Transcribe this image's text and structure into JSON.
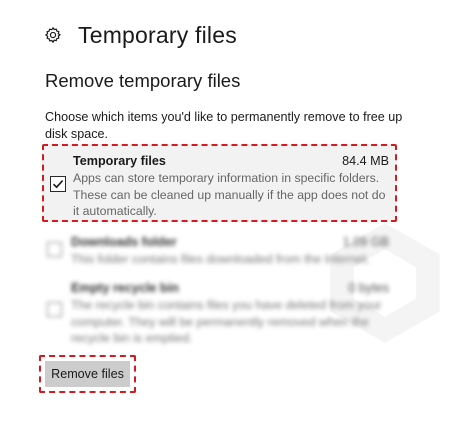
{
  "header": {
    "icon": "gear-icon",
    "title": "Temporary files"
  },
  "section": {
    "title": "Remove temporary files",
    "intro": "Choose which items you'd like to permanently remove to free up disk space."
  },
  "items": [
    {
      "name": "Temporary files",
      "size": "84.4 MB",
      "description": "Apps can store temporary information in specific folders. These can be cleaned up manually if the app does not do it automatically.",
      "checked": true
    },
    {
      "name": "Downloads folder",
      "size": "1.09 GB",
      "description": "This folder contains files downloaded from the Internet.",
      "checked": false
    },
    {
      "name": "Empty recycle bin",
      "size": "0 bytes",
      "description": "The recycle bin contains files you have deleted from your computer. They will be permanently removed when the recycle bin is emptied.",
      "checked": false
    }
  ],
  "actions": {
    "remove_label": "Remove files"
  },
  "colors": {
    "highlight": "#d71920",
    "button_bg": "#cccccc",
    "selected_bg": "#f2f2f2"
  }
}
